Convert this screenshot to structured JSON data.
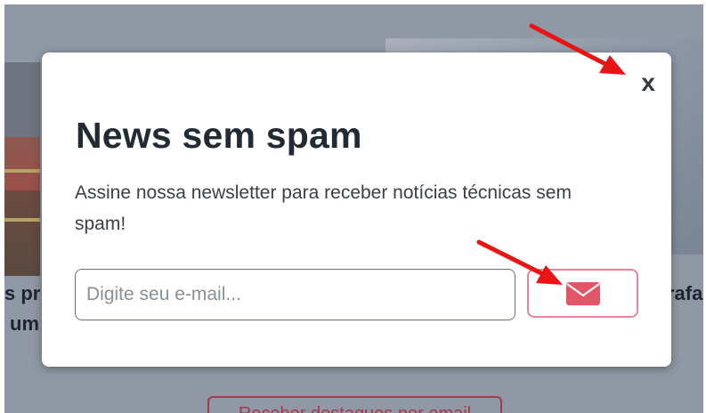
{
  "modal": {
    "close_label": "x",
    "title": "News sem spam",
    "description": "Assine nossa newsletter para receber notícias técnicas sem spam!",
    "email_placeholder": "Digite seu e-mail...",
    "submit_icon": "envelope-icon"
  },
  "background": {
    "left_text_line1": "s pr",
    "left_text_line2": "um",
    "right_text": "rafa",
    "bottom_button_label": "Receber destaques por email"
  },
  "annotations": {
    "arrow_color": "#e81515"
  },
  "colors": {
    "accent": "#e25566",
    "accent_border": "#e8839a",
    "overlay": "#8f98a4"
  }
}
